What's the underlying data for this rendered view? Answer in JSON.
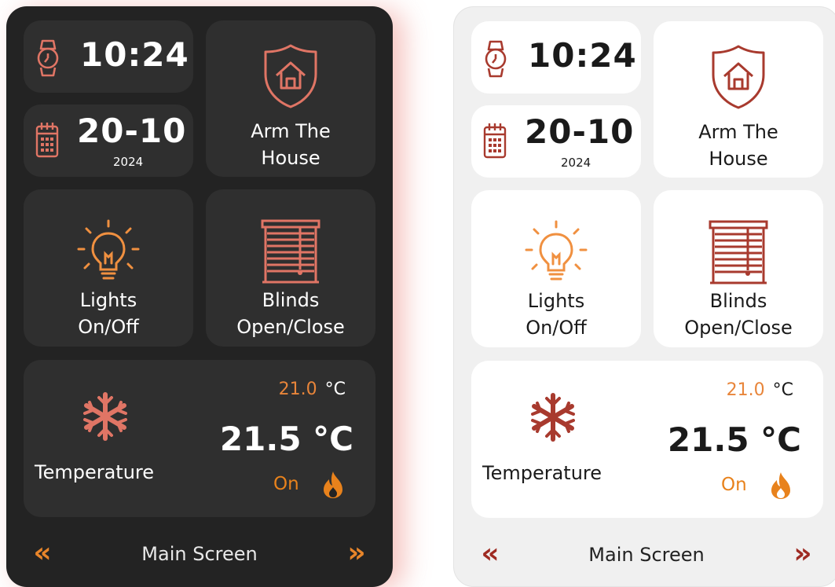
{
  "colors": {
    "dark_panel_bg": "#232323",
    "dark_card_bg": "#2f2f2f",
    "light_panel_bg": "#f0f0f0",
    "light_card_bg": "#ffffff",
    "dark_icon_accent": "#e07565",
    "light_icon_accent": "#a83a2e",
    "bulb_orange": "#f09040",
    "heat_orange": "#e8821c"
  },
  "panels": [
    {
      "theme": "dark",
      "clock": {
        "time": "10:24",
        "icon": "watch-icon"
      },
      "date": {
        "day_month": "20-10",
        "year": "2024",
        "icon": "calendar-icon"
      },
      "arm": {
        "label_line1": "Arm The",
        "label_line2": "House",
        "icon": "shield-home-icon"
      },
      "lights": {
        "label_line1": "Lights",
        "label_line2": "On/Off",
        "icon": "light-bulb-icon"
      },
      "blinds": {
        "label_line1": "Blinds",
        "label_line2": "Open/Close",
        "icon": "blinds-icon"
      },
      "temperature": {
        "label": "Temperature",
        "setpoint": "21.0",
        "setpoint_unit": "°C",
        "current": "21.5 °C",
        "status": "On",
        "icon": "snowflake-icon",
        "status_icon": "flame-icon"
      },
      "footer": {
        "title": "Main Screen",
        "prev": "«",
        "next": "»"
      }
    },
    {
      "theme": "light",
      "clock": {
        "time": "10:24",
        "icon": "watch-icon"
      },
      "date": {
        "day_month": "20-10",
        "year": "2024",
        "icon": "calendar-icon"
      },
      "arm": {
        "label_line1": "Arm The",
        "label_line2": "House",
        "icon": "shield-home-icon"
      },
      "lights": {
        "label_line1": "Lights",
        "label_line2": "On/Off",
        "icon": "light-bulb-icon"
      },
      "blinds": {
        "label_line1": "Blinds",
        "label_line2": "Open/Close",
        "icon": "blinds-icon"
      },
      "temperature": {
        "label": "Temperature",
        "setpoint": "21.0",
        "setpoint_unit": "°C",
        "current": "21.5 °C",
        "status": "On",
        "icon": "snowflake-icon",
        "status_icon": "flame-icon"
      },
      "footer": {
        "title": "Main Screen",
        "prev": "«",
        "next": "»"
      }
    }
  ]
}
